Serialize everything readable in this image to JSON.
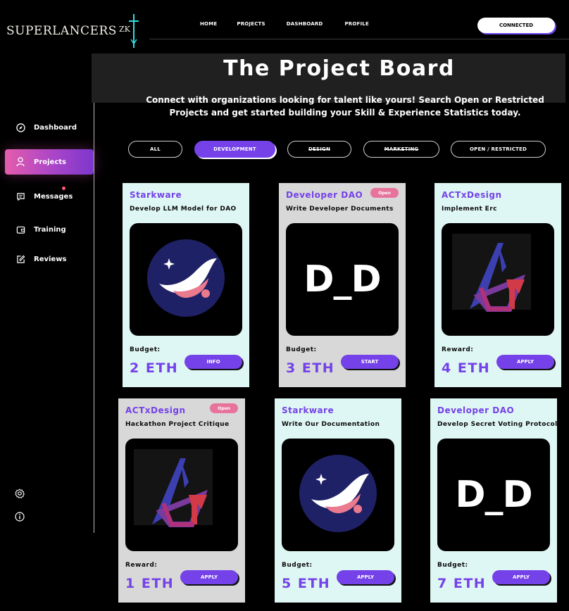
{
  "brand": {
    "name": "SUPERLANCERS",
    "suffix": "ZK"
  },
  "nav": {
    "links": [
      "HOME",
      "PROJECTS",
      "DASHBOARD",
      "PROFILE"
    ],
    "status_button": "CONNECTED"
  },
  "sidebar": {
    "items": [
      {
        "label": "Dashboard",
        "icon": "compass-icon"
      },
      {
        "label": "Projects",
        "icon": "user-icon",
        "active": true
      },
      {
        "label": "Messages",
        "icon": "chat-icon",
        "notification": true
      },
      {
        "label": "Training",
        "icon": "wallet-icon"
      },
      {
        "label": "Reviews",
        "icon": "edit-icon"
      }
    ],
    "bottom_icons": [
      "settings-icon",
      "info-icon"
    ]
  },
  "board": {
    "title": "The Project Board",
    "subtitle": "Connect with organizations looking for talent like yours! Search Open or Restricted Projects and get started building your Skill & Experience Statistics today."
  },
  "filters": [
    {
      "label": "ALL",
      "active": false
    },
    {
      "label": "DEVELOPMENT",
      "active": true
    },
    {
      "label": "DESIGN",
      "active": false,
      "struck": true
    },
    {
      "label": "MARKETING",
      "active": false,
      "struck": true
    },
    {
      "label": "OPEN / RESTRICTED",
      "active": false
    }
  ],
  "projects": [
    {
      "org": "Starkware",
      "title": "Develop LLM Model for DAO",
      "art": "starkware-logo",
      "amount_label": "Budget:",
      "amount": "2 ETH",
      "button": "INFO",
      "badge": "",
      "theme": "mint"
    },
    {
      "org": "Developer DAO",
      "title": "Write Developer Documents",
      "art": "developer-dao-logo",
      "amount_label": "Budget:",
      "amount": "3 ETH",
      "button": "START",
      "badge": "Open",
      "theme": "grey"
    },
    {
      "org": "ACTxDesign",
      "title": "Implement Erc",
      "art": "actxdesign-logo",
      "amount_label": "Reward:",
      "amount": "4 ETH",
      "button": "APPLY",
      "badge": "",
      "theme": "mint"
    },
    {
      "org": "ACTxDesign",
      "title": "Hackathon Project Critique",
      "art": "actxdesign-logo",
      "amount_label": "Reward:",
      "amount": "1 ETH",
      "button": "APPLY",
      "badge": "Open",
      "theme": "grey"
    },
    {
      "org": "Starkware",
      "title": "Write Our Documentation",
      "art": "starkware-logo",
      "amount_label": "Budget:",
      "amount": "5 ETH",
      "button": "APPLY",
      "badge": "",
      "theme": "mint"
    },
    {
      "org": "Developer DAO",
      "title": "Develop Secret Voting Protocol",
      "art": "developer-dao-logo",
      "amount_label": "Budget:",
      "amount": "7 ETH",
      "button": "APPLY",
      "badge": "",
      "theme": "mint"
    }
  ],
  "art_text": {
    "developer_dao": "D_D"
  },
  "colors": {
    "accent": "#7442e8",
    "badge": "#e7739c",
    "card_mint": "#dff7f4",
    "card_grey": "#d8d8d8",
    "active_nav": "#c54bbf"
  }
}
